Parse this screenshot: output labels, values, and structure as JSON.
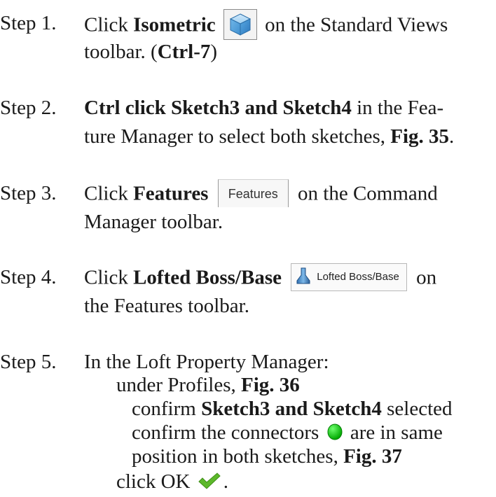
{
  "step1": {
    "label": "Step 1.",
    "click": "Click",
    "isometric": "Isometric",
    "rest": "on the Standard Views",
    "line2a": "toolbar. (",
    "shortcut": "Ctrl-7",
    "line2b": ")",
    "icon": "isometric-cube-icon"
  },
  "step2": {
    "label": "Step 2.",
    "bold": "Ctrl click Sketch3 and Sketch4",
    "rest": "in the Fea-",
    "line2a": "ture Manager to select both sketches,",
    "fig": "Fig. 35",
    "line2b": "."
  },
  "step3": {
    "label": "Step 3.",
    "click": "Click",
    "features": "Features",
    "tab_label": "Features",
    "rest": "on the Command",
    "line2": "Manager toolbar."
  },
  "step4": {
    "label": "Step 4.",
    "click": "Click",
    "bold": "Lofted Boss/Base",
    "button_label": "Lofted Boss/Base",
    "rest": "on",
    "line2": "the Features toolbar.",
    "icon": "loft-icon"
  },
  "step5": {
    "label": "Step 5.",
    "line1": "In the Loft Property Manager:",
    "line2a": "under Profiles,",
    "line2fig": "Fig. 36",
    "line3a": "confirm",
    "line3bold": "Sketch3 and Sketch4",
    "line3b": "selected",
    "line4a": "confirm the connectors",
    "line4b": "are in same",
    "line5a": "position in both sketches,",
    "line5fig": "Fig. 37",
    "line6": "click OK",
    "line6end": ".",
    "connector_color": "#00c000",
    "check_color": "#5cb82a"
  }
}
